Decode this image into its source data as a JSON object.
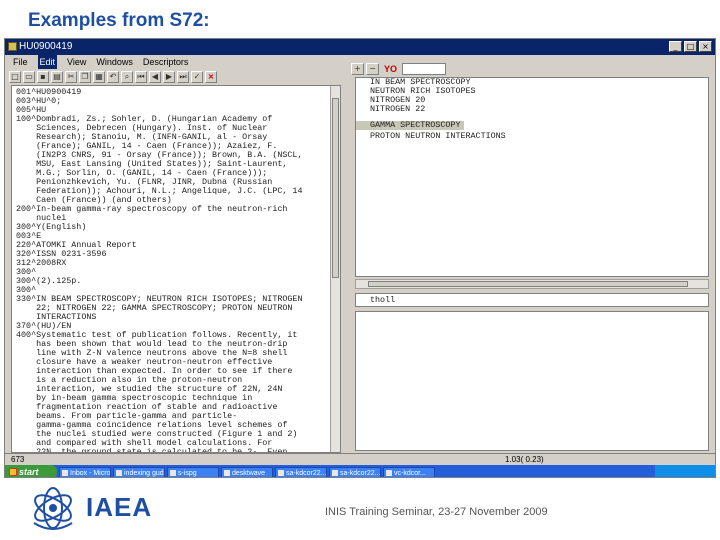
{
  "slide": {
    "title": "Examples from S72:",
    "footer_org": "IAEA",
    "footer_text": "INIS Training Seminar, 23-27 November 2009"
  },
  "window": {
    "title": "HU0900419",
    "menu": [
      "File",
      "Edit",
      "View",
      "Windows",
      "Descriptors"
    ],
    "active_menu_index": 1,
    "toolbar_icons": [
      "new-icon",
      "open-icon",
      "save-icon",
      "print-icon",
      "cut-icon",
      "copy-icon",
      "paste-icon",
      "undo-icon",
      "find-icon",
      "first-icon",
      "prev-icon",
      "next-icon",
      "last-icon",
      "check-icon",
      "close-red-icon"
    ]
  },
  "record": {
    "lines": [
      "001^HU0900419",
      "003^HU^0;",
      "005^HU",
      "100^Dombradi, Zs.; Sohler, D. (Hungarian Academy of",
      "    Sciences, Debrecen (Hungary). Inst. of Nuclear",
      "    Research); Stanoiu, M. (INFN-GANIL, al - Orsay",
      "    (France); GANIL, 14 - Caen (France)); Azaiez, F.",
      "    (IN2P3 CNRS, 91 - Orsay (France)); Brown, B.A. (NSCL,",
      "    MSU, East Lansing (United States)); Saint-Laurent,",
      "    M.G.; Sorlin, O. (GANIL, 14 - Caen (France)));",
      "    Penionzhkevich, Yu. (FLNR, JINR, Dubna (Russian",
      "    Federation)); Achouri, N.L.; Angelique, J.C. (LPC, 14",
      "    Caen (France)) (and others)",
      "200^In-beam gamma-ray spectroscopy of the neutron-rich",
      "    nuclei",
      "300^Y(English)",
      "003^E",
      "220^ATOMKI Annual Report",
      "320^ISSN 0231-3596",
      "312^2008RX",
      "300^",
      "300^(2).125p.",
      "300^",
      "330^IN BEAM SPECTROSCOPY; NEUTRON RICH ISOTOPES; NITROGEN",
      "    22; NITROGEN 22; GAMMA SPECTROSCOPY; PROTON NEUTRON",
      "    INTERACTIONS",
      "370^(HU)/EN",
      "400^Systematic test of publication follows. Recently, it",
      "    has been shown that would lead to the neutron-drip",
      "    line with Z-N valence neutrons above the N=8 shell",
      "    closure have a weaker neutron-neutron effective",
      "    interaction than expected. In order to see if there",
      "    is a reduction also in the proton-neutron",
      "    interaction, we studied the structure of 22N, 24N",
      "    by in-beam gamma spectroscopic technique in",
      "    fragmentation reaction of stable and radioactive",
      "    beams. From particle-gamma and particle-",
      "    gamma-gamma coincidence relations level schemes of",
      "    the nuclei studied were constructed (Figure 1 and 2)",
      "    and compared with shell model calculations. For",
      "    22N, the ground state is calculated to be 2-. Even",
      "    though, the calculated level density is much higher",
      "    than the experimental one, the assignment of the 840",
      "    keV state to the 3- level, the 1850 keV state to the",
      "    3- , and the 2613 keV state to the 1- one seems",
      "    to be reasonable. The 4- state lying above the",
      "    neutron separation energy cannot be observed by"
    ]
  },
  "descriptors": {
    "items": [
      "IN BEAM SPECTROSCOPY",
      "NEUTRON RICH ISOTOPES",
      "NITROGEN 20",
      "NITROGEN 22",
      "GAMMA SPECTROSCOPY",
      "PROTON NEUTRON INTERACTIONS"
    ],
    "selected_index": 4,
    "input_value": "tholl",
    "yo_label": "YO"
  },
  "status": {
    "left": "673",
    "right": "1.03( 0.23)"
  },
  "taskbar": {
    "start_label": "start",
    "tasks": [
      "Inbox - Micro...",
      "indexing gude...",
      "s-ispg",
      "desktwave",
      "sa-kdcor22...",
      "sa-kdcor22...",
      "vc-kdcor..."
    ],
    "tray_time": ""
  }
}
